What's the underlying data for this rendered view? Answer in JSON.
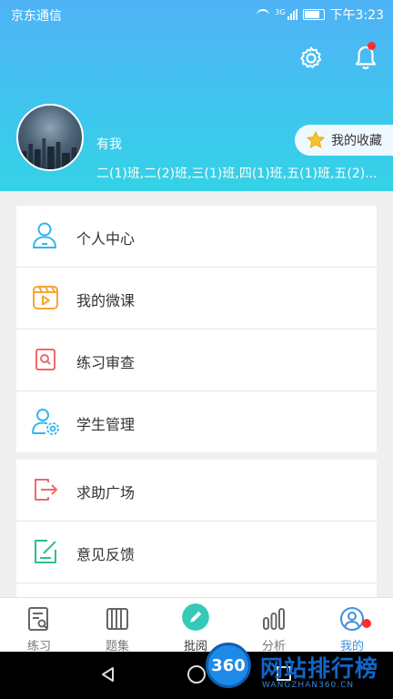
{
  "status_bar": {
    "carrier": "京东通信",
    "network": "3G",
    "time": "下午3:23"
  },
  "header": {
    "username": "有我",
    "classes": "二(1)班,二(2)班,三(1)班,四(1)班,五(1)班,五(2)...",
    "favorites_label": "我的收藏",
    "notification_badge_color": "#ff2d2d"
  },
  "menu_group_1": [
    {
      "label": "个人中心",
      "icon": "person-icon"
    },
    {
      "label": "我的微课",
      "icon": "video-icon"
    },
    {
      "label": "练习审查",
      "icon": "search-document-icon"
    },
    {
      "label": "学生管理",
      "icon": "person-settings-icon"
    }
  ],
  "menu_group_2": [
    {
      "label": "求助广场",
      "icon": "exit-icon"
    },
    {
      "label": "意见反馈",
      "icon": "feedback-edit-icon"
    }
  ],
  "tabs": [
    {
      "label": "练习",
      "icon": "practice-icon",
      "active": false
    },
    {
      "label": "题集",
      "icon": "question-set-icon",
      "active": false
    },
    {
      "label": "批阅",
      "icon": "pencil-icon",
      "active": false
    },
    {
      "label": "分析",
      "icon": "analysis-icon",
      "active": false
    },
    {
      "label": "我的",
      "icon": "profile-icon",
      "active": true
    }
  ],
  "watermark": {
    "badge": "360",
    "title": "网站排行榜",
    "subtitle": "WANGZHAN360.CN"
  },
  "colors": {
    "accent": "#3d8fe0",
    "header_top": "#4fb3f6",
    "header_bottom": "#34d2e6",
    "badge": "#ff2d2d"
  }
}
